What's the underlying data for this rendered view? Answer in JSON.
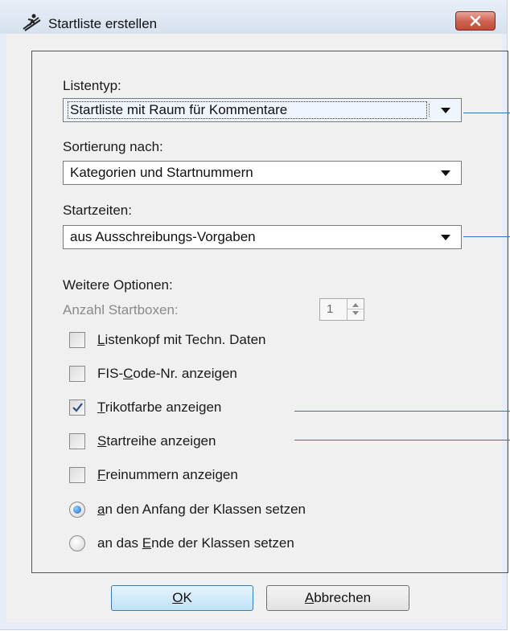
{
  "window": {
    "title": "Startliste erstellen",
    "icon": "skier-icon",
    "close_icon": "close-x-icon"
  },
  "fields": {
    "list_type": {
      "label": "Listentyp:",
      "value": "Startliste mit Raum für Kommentare"
    },
    "sort_by": {
      "label": "Sortierung nach:",
      "value": "Kategorien und Startnummern"
    },
    "start_times": {
      "label": "Startzeiten:",
      "value": "aus Ausschreibungs-Vorgaben"
    }
  },
  "options": {
    "heading": "Weitere Optionen:",
    "start_boxes_label": "Anzahl Startboxen:",
    "start_boxes_value": "1",
    "checkboxes": [
      {
        "pre": "",
        "u": "L",
        "post": "istenkopf mit Techn. Daten",
        "checked": false
      },
      {
        "pre": "FIS-",
        "u": "C",
        "post": "ode-Nr. anzeigen",
        "checked": false
      },
      {
        "pre": "",
        "u": "T",
        "post": "rikotfarbe anzeigen",
        "checked": true
      },
      {
        "pre": "",
        "u": "S",
        "post": "tartreihe anzeigen",
        "checked": false
      },
      {
        "pre": "",
        "u": "F",
        "post": "reinummern anzeigen",
        "checked": false
      }
    ],
    "radios": [
      {
        "pre": "",
        "u": "a",
        "post": "n den Anfang der Klassen setzen",
        "selected": true
      },
      {
        "pre": "an das ",
        "u": "E",
        "post": "nde der Klassen setzen",
        "selected": false
      }
    ]
  },
  "buttons": {
    "ok": {
      "pre": "",
      "u": "O",
      "post": "K"
    },
    "cancel": {
      "pre": "",
      "u": "A",
      "post": "bbrechen"
    }
  },
  "colors": {
    "accent": "#3a72b8",
    "close_button": "#c44a38",
    "default_button": "#bfe2f8"
  }
}
